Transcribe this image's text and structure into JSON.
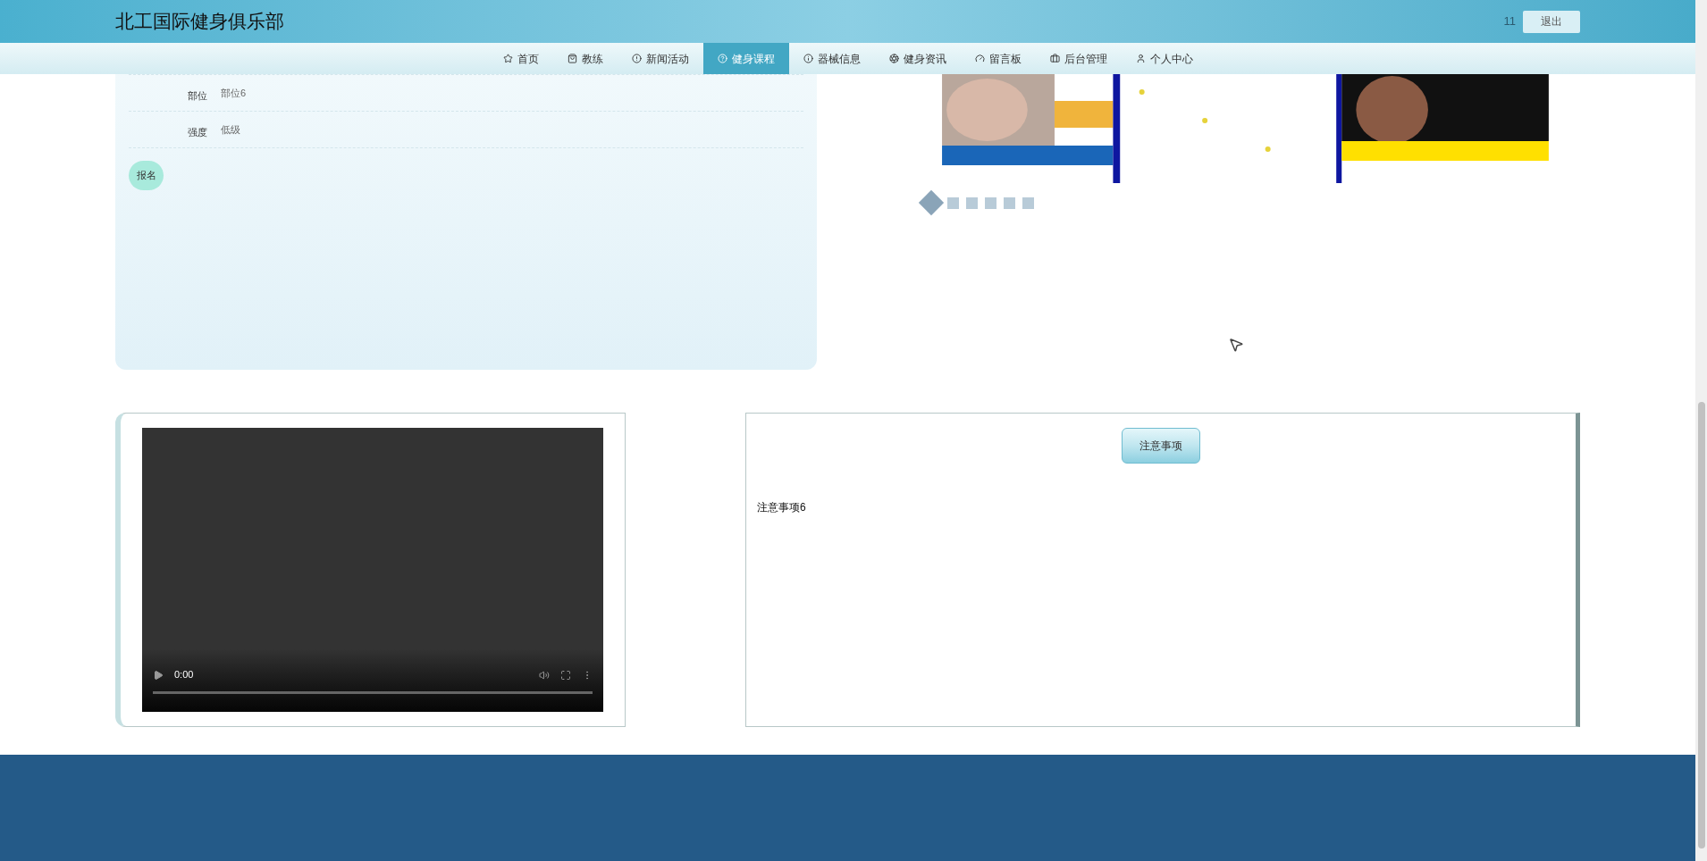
{
  "header": {
    "title": "北工国际健身俱乐部",
    "user": "11",
    "logout": "退出"
  },
  "nav": [
    {
      "label": "首页",
      "selected": false
    },
    {
      "label": "教练",
      "selected": false
    },
    {
      "label": "新闻活动",
      "selected": false
    },
    {
      "label": "健身课程",
      "selected": true
    },
    {
      "label": "器械信息",
      "selected": false
    },
    {
      "label": "健身资讯",
      "selected": false
    },
    {
      "label": "留言板",
      "selected": false
    },
    {
      "label": "后台管理",
      "selected": false
    },
    {
      "label": "个人中心",
      "selected": false
    }
  ],
  "details": [
    {
      "label": "部位",
      "value": "部位6"
    },
    {
      "label": "强度",
      "value": "低级"
    }
  ],
  "signup_button": "报名",
  "carousel": {
    "kind": "picture",
    "dots": [
      {
        "selected": true
      },
      {
        "selected": false
      },
      {
        "selected": false
      },
      {
        "selected": false
      },
      {
        "selected": false
      },
      {
        "selected": false
      }
    ]
  },
  "video": {
    "time": "0:00"
  },
  "notice": {
    "heading": "注意事项",
    "text": "注意事项6"
  }
}
